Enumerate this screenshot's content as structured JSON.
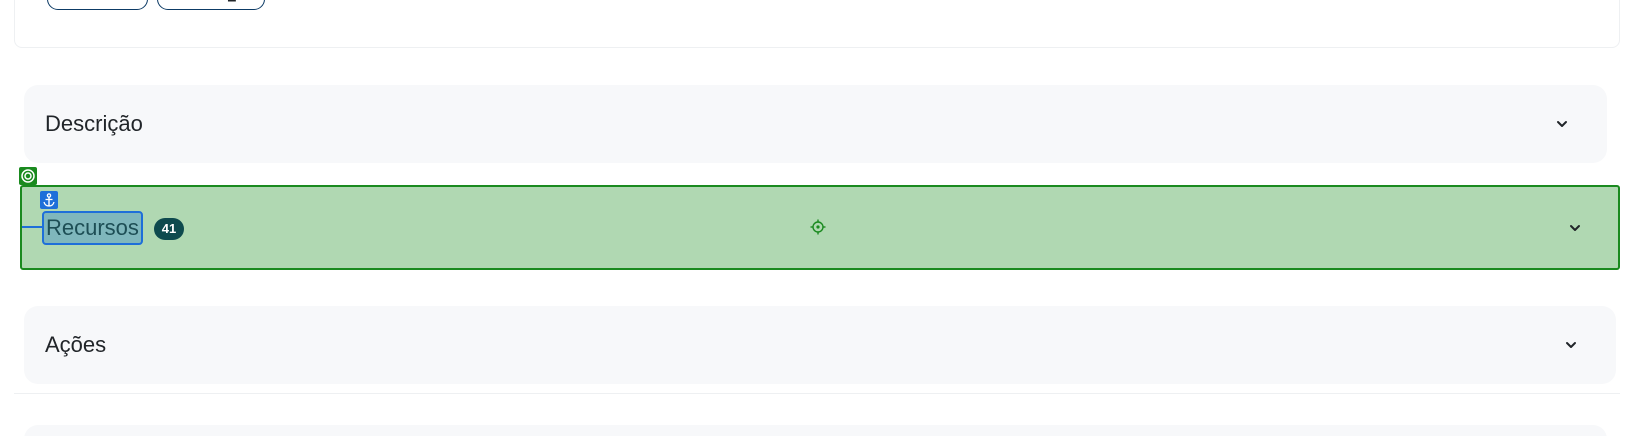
{
  "accordions": {
    "descricao": {
      "title": "Descrição"
    },
    "recursos": {
      "title": "Recursos",
      "count": "41"
    },
    "acoes": {
      "title": "Ações"
    }
  },
  "icons": {
    "chevron": "chevron-down-icon",
    "target": "target-icon",
    "anchor": "anchor-icon",
    "crosshair": "crosshair-icon"
  },
  "colors": {
    "highlight_fill": "#b0d8b2",
    "highlight_border": "#1a8a1f",
    "anchor_blue": "#1e6fd9",
    "badge_bg": "#0e4a4e",
    "panel_bg": "#f7f8fa"
  }
}
